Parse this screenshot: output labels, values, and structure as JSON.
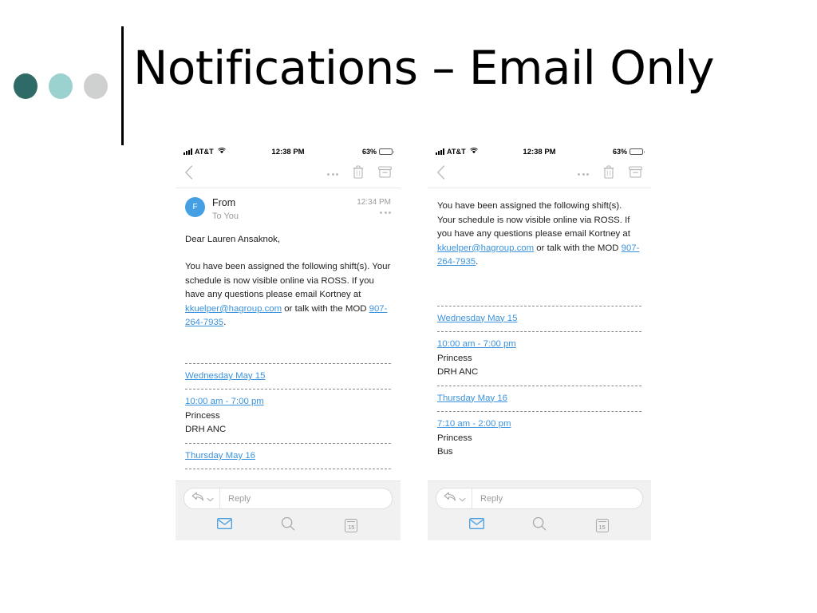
{
  "slide": {
    "title": "Notifications – Email Only",
    "accent_dots": [
      "#2e6b66",
      "#9bd2d0",
      "#cfd1d0"
    ],
    "rule_color": "#000000"
  },
  "link_color": "#3b93dd",
  "avatar_color": "#44a0e3",
  "status_bar": {
    "carrier": "AT&T",
    "time": "12:38 PM",
    "battery_percent": "63%",
    "signal_icon": "signal-bars-icon",
    "wifi_icon": "wifi-icon",
    "battery_icon": "battery-icon"
  },
  "nav_bar": {
    "back_icon": "chevron-left-icon",
    "more_icon": "ellipsis-icon",
    "trash_icon": "trash-icon",
    "archive_icon": "archive-icon"
  },
  "bottom_bar": {
    "reply_icon": "reply-arrow-icon",
    "reply_chevron_icon": "chevron-down-icon",
    "reply_placeholder": "Reply",
    "tabs": [
      {
        "name": "mail",
        "icon": "envelope-icon",
        "active": true
      },
      {
        "name": "search",
        "icon": "search-icon",
        "active": false
      },
      {
        "name": "calendar",
        "icon": "calendar-icon",
        "day": "15",
        "active": false
      }
    ]
  },
  "phone_left": {
    "mail_header": {
      "from": "From",
      "to": "To You",
      "time": "12:34 PM",
      "avatar_initial": "F",
      "more_icon": "ellipsis-icon"
    },
    "body": {
      "greeting": "Dear Lauren Ansaknok,",
      "paragraph_1": "You have been assigned the following shift(s). Your schedule is now visible online via ROSS. If you have any questions please email Kortney at ",
      "email_link": "kkuelper@hagroup.com",
      "paragraph_2": " or talk with the MOD ",
      "phone_link": "907-264-7935",
      "paragraph_3": "."
    },
    "schedule": [
      {
        "day": "Wednesday May 15",
        "time": "10:00 am - 7:00 pm",
        "line_1": "Princess",
        "line_2": "DRH ANC"
      },
      {
        "day": "Thursday May 16",
        "time": "",
        "line_1": "",
        "line_2": ""
      }
    ]
  },
  "phone_right": {
    "body": {
      "paragraph_1": "You have been assigned the following shift(s). Your schedule is now visible online via ROSS. If you have any questions please email Kortney at ",
      "email_link": "kkuelper@hagroup.com",
      "paragraph_2": " or talk with the MOD ",
      "phone_link": "907-264-7935",
      "paragraph_3": "."
    },
    "schedule": [
      {
        "day": "Wednesday May 15",
        "time": "10:00 am - 7:00 pm",
        "line_1": "Princess",
        "line_2": "DRH ANC"
      },
      {
        "day": "Thursday May 16",
        "time": "7:10 am - 2:00 pm",
        "line_1": "Princess",
        "line_2": "Bus"
      }
    ]
  }
}
